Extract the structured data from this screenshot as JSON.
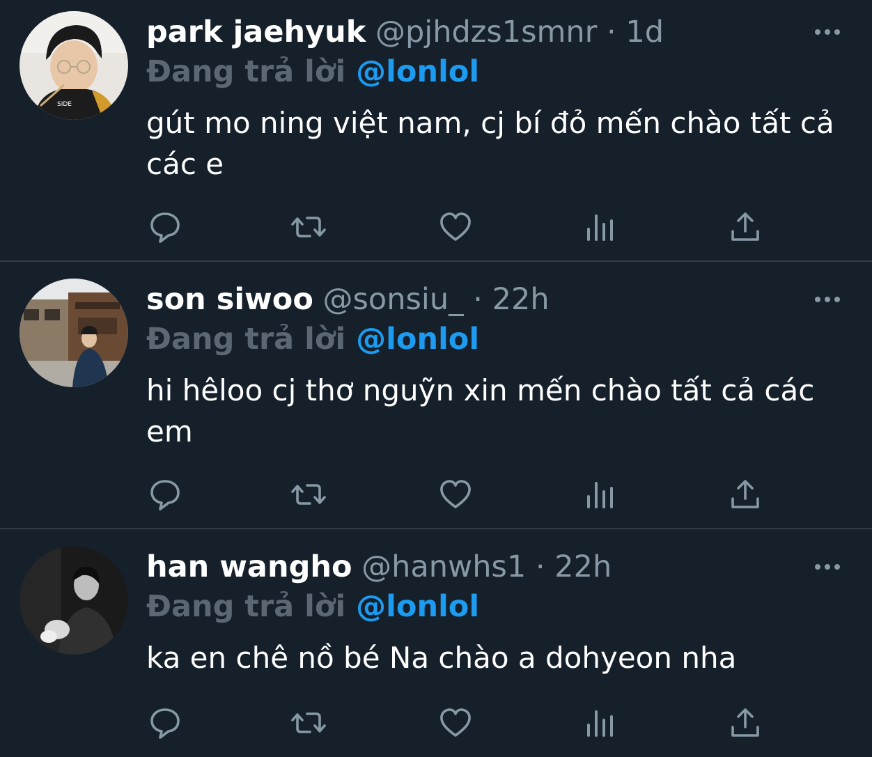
{
  "tweets": [
    {
      "display_name": "park jaehyuk",
      "handle": "@pjhdzs1smnr",
      "separator": "·",
      "time": "1d",
      "reply_label": "Đang trả lời",
      "reply_to": "@lonlol",
      "text": "gút mo ning việt nam, cj bí đỏ mến chào tất cả các e"
    },
    {
      "display_name": "son siwoo",
      "handle": "@sonsiu_",
      "separator": "·",
      "time": "22h",
      "reply_label": "Đang trả lời",
      "reply_to": "@lonlol",
      "text": "hi hêloo cj thơ nguỹn xin mến chào tất cả các em"
    },
    {
      "display_name": "han wangho",
      "handle": "@hanwhs1",
      "separator": "·",
      "time": "22h",
      "reply_label": "Đang trả lời",
      "reply_to": "@lonlol",
      "text": "ka en chê nồ bé Na chào a dohyeon nha"
    }
  ],
  "icons": {
    "reply": "reply-icon",
    "retweet": "retweet-icon",
    "like": "heart-icon",
    "analytics": "analytics-icon",
    "share": "share-icon",
    "more": "more-icon"
  },
  "colors": {
    "background": "#15202b",
    "divider": "#2f3c48",
    "secondary_text": "#8899a6",
    "reply_label": "#5b6874",
    "mention": "#1d9bf0",
    "icon": "#8899a6"
  }
}
